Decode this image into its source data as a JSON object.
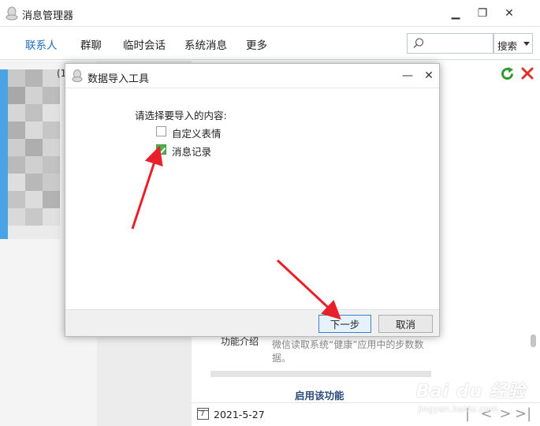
{
  "window": {
    "title": "消息管理器",
    "minimize": "▁",
    "restore": "❐",
    "close": "✕"
  },
  "nav": {
    "tabs": [
      {
        "label": "联系人",
        "active": true
      },
      {
        "label": "群聊"
      },
      {
        "label": "临时会话"
      },
      {
        "label": "系统消息"
      },
      {
        "label": "更多"
      }
    ],
    "search_placeholder": "",
    "search_button": "搜索"
  },
  "left_pane": {
    "partial_count": "(1"
  },
  "content": {
    "feature_label": "功能介绍",
    "feature_desc": "微信读取系统“健康”应用中的步数数据。",
    "enable_button": "启用该功能"
  },
  "bottombar": {
    "calendar_day": "7",
    "date": "2021-5-27",
    "first_page": "|<",
    "prev_page": "<",
    "next_page": ">",
    "last_page": ">|"
  },
  "dialog": {
    "title": "数据导入工具",
    "minimize": "—",
    "close": "✕",
    "prompt": "请选择要导入的内容:",
    "options": [
      {
        "label": "自定义表情",
        "checked": false
      },
      {
        "label": "消息记录",
        "checked": true
      }
    ],
    "next_button": "下一步",
    "cancel_button": "取消"
  },
  "watermark": {
    "brand": "Bai du 经验",
    "url": "jingyan.baidu.com"
  },
  "colors": {
    "accent_blue": "#1f6fb8",
    "check_green": "#4caf50",
    "annotation_red": "#e8202a",
    "refresh_green": "#2e9b2e",
    "delete_red": "#d8322b"
  }
}
